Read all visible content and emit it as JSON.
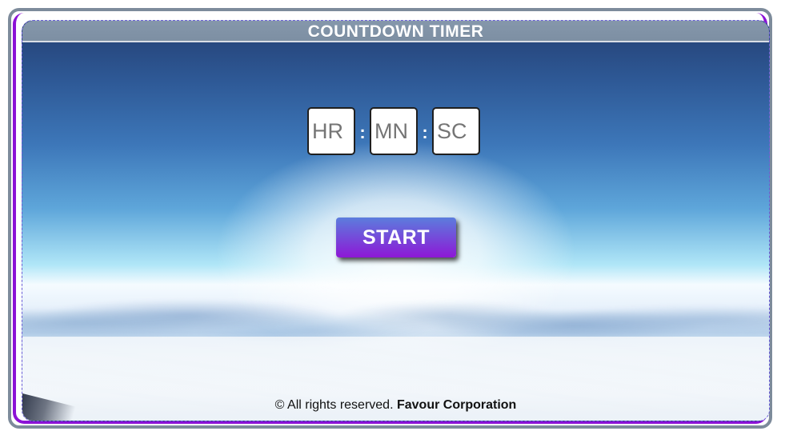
{
  "header": {
    "title": "COUNTDOWN TIMER"
  },
  "timer": {
    "hours_placeholder": "HR",
    "minutes_placeholder": "MN",
    "seconds_placeholder": "SC",
    "separator_1": ":",
    "separator_2": ":"
  },
  "actions": {
    "start_label": "START"
  },
  "footer": {
    "copyright": "© All rights reserved.",
    "company": "Favour Corporation"
  },
  "colors": {
    "header_bar": "#7d8fa3",
    "accent_purple": "#8b12d6",
    "button_top": "#5b7ddd",
    "button_bottom": "#8d18d6"
  }
}
